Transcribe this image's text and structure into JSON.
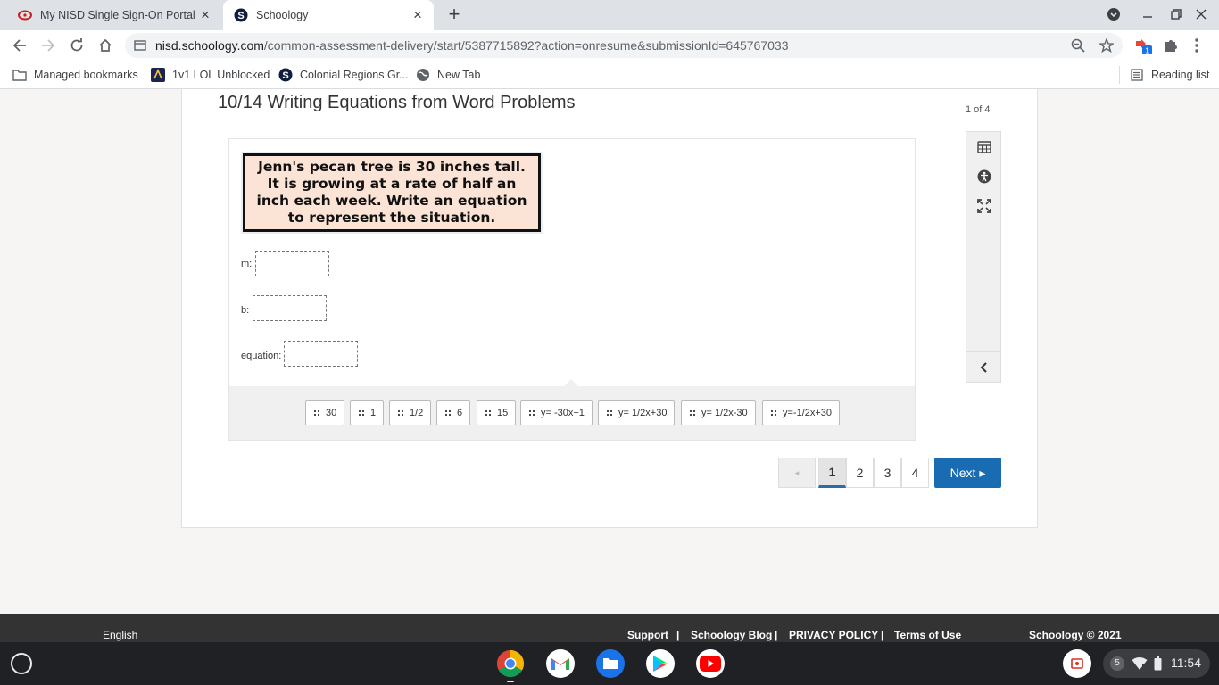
{
  "browser": {
    "tabs": [
      {
        "title": "My NISD Single Sign-On Portal",
        "icon": "portal-icon"
      },
      {
        "title": "Schoology",
        "icon": "schoology-icon"
      }
    ],
    "url_host": "nisd.schoology.com",
    "url_path": "/common-assessment-delivery/start/5387715892?action=onresume&submissionId=645767033",
    "extension_badge": "1",
    "bookmarks": [
      {
        "label": "Managed bookmarks",
        "icon": "folder-icon"
      },
      {
        "label": "1v1 LOL Unblocked",
        "icon": "game-icon"
      },
      {
        "label": "Colonial Regions Gr...",
        "icon": "schoology-icon"
      },
      {
        "label": "New Tab",
        "icon": "globe-icon"
      }
    ],
    "reading_list": "Reading list"
  },
  "assessment": {
    "title": "10/14 Writing Equations from Word Problems",
    "page_count": "1 of 4",
    "prompt_text": "Jenn's pecan tree is 30 inches tall. It is growing at a rate of half an inch each week. Write an equation to represent the situation.",
    "fields": [
      {
        "label": "m:",
        "value": ""
      },
      {
        "label": "b:",
        "value": ""
      },
      {
        "label": "equation:",
        "value": ""
      }
    ],
    "choices": [
      "30",
      "1",
      "1/2",
      "6",
      "15",
      "y= -30x+1",
      "y= 1/2x+30",
      "y= 1/2x-30",
      "y=-1/2x+30"
    ],
    "tools": [
      "calculator-icon",
      "accessibility-icon",
      "fullscreen-icon",
      "collapse-chevron-icon"
    ]
  },
  "pagination": {
    "prev": "◂",
    "pages": [
      "1",
      "2",
      "3",
      "4"
    ],
    "current": "1",
    "next": "Next ▸"
  },
  "footer": {
    "language": "English",
    "support": "Support",
    "blog": "Schoology Blog",
    "privacy": "PRIVACY POLICY",
    "terms": "Terms of Use",
    "sep": "|",
    "copyright": "Schoology © 2021"
  },
  "shelf": {
    "apps": [
      "chrome-icon",
      "gmail-icon",
      "files-icon",
      "play-store-icon",
      "youtube-icon"
    ],
    "notification_count": "5",
    "time": "11:54"
  },
  "colors": {
    "next_button": "#1a6cb2",
    "footer": "#333333",
    "prompt_bg": "#fbe3d6"
  }
}
